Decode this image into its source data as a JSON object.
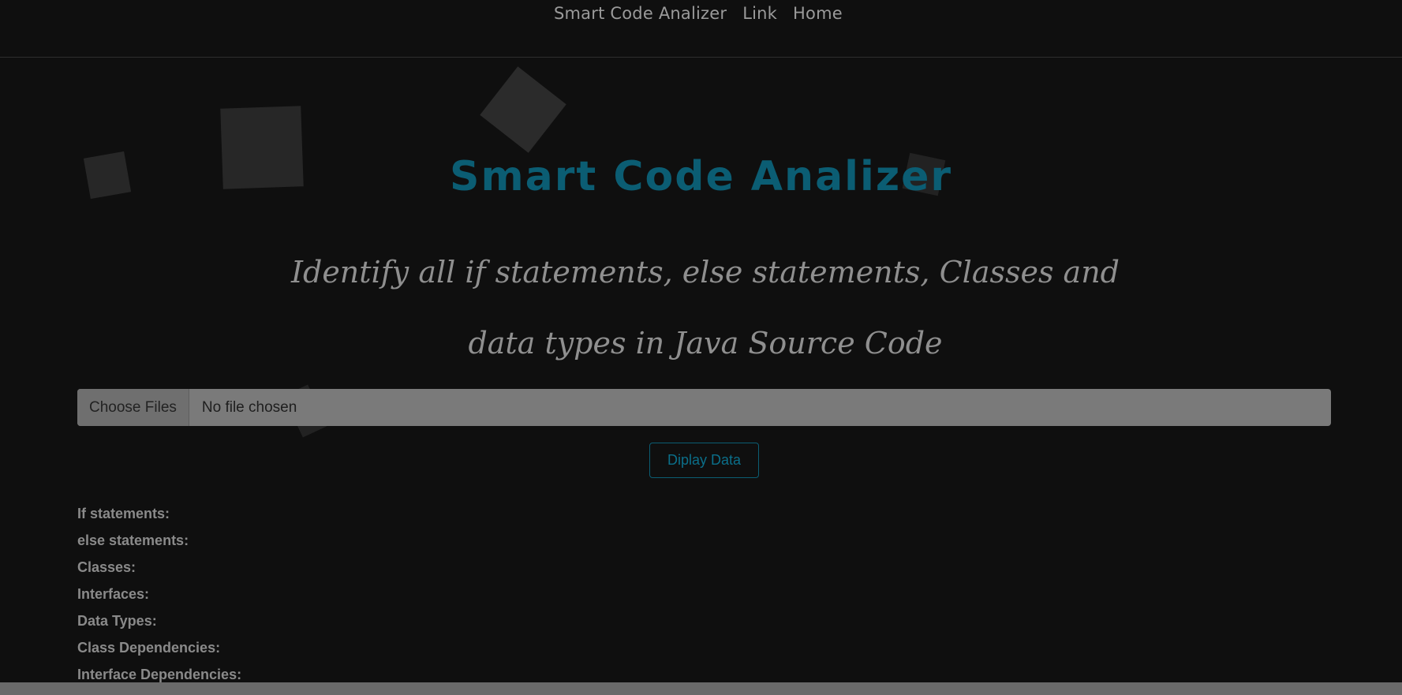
{
  "nav": {
    "brand": "Smart Code Analizer",
    "link": "Link",
    "home": "Home"
  },
  "hero": {
    "title": "Smart Code Analizer",
    "subtitle": "Identify all if statements, else statements, Classes and data types in Java Source Code"
  },
  "upload": {
    "button_label": "Choose Files",
    "status": "No file chosen"
  },
  "actions": {
    "display_label": "Diplay Data"
  },
  "results": [
    {
      "label": "If statements:"
    },
    {
      "label": "else statements:"
    },
    {
      "label": "Classes:"
    },
    {
      "label": "Interfaces:"
    },
    {
      "label": "Data Types:"
    },
    {
      "label": "Class Dependencies:"
    },
    {
      "label": "Interface Dependencies:"
    }
  ],
  "colors": {
    "background": "#0f0f0f",
    "accent": "#0b5d73",
    "text_muted": "#8a8a8a"
  }
}
